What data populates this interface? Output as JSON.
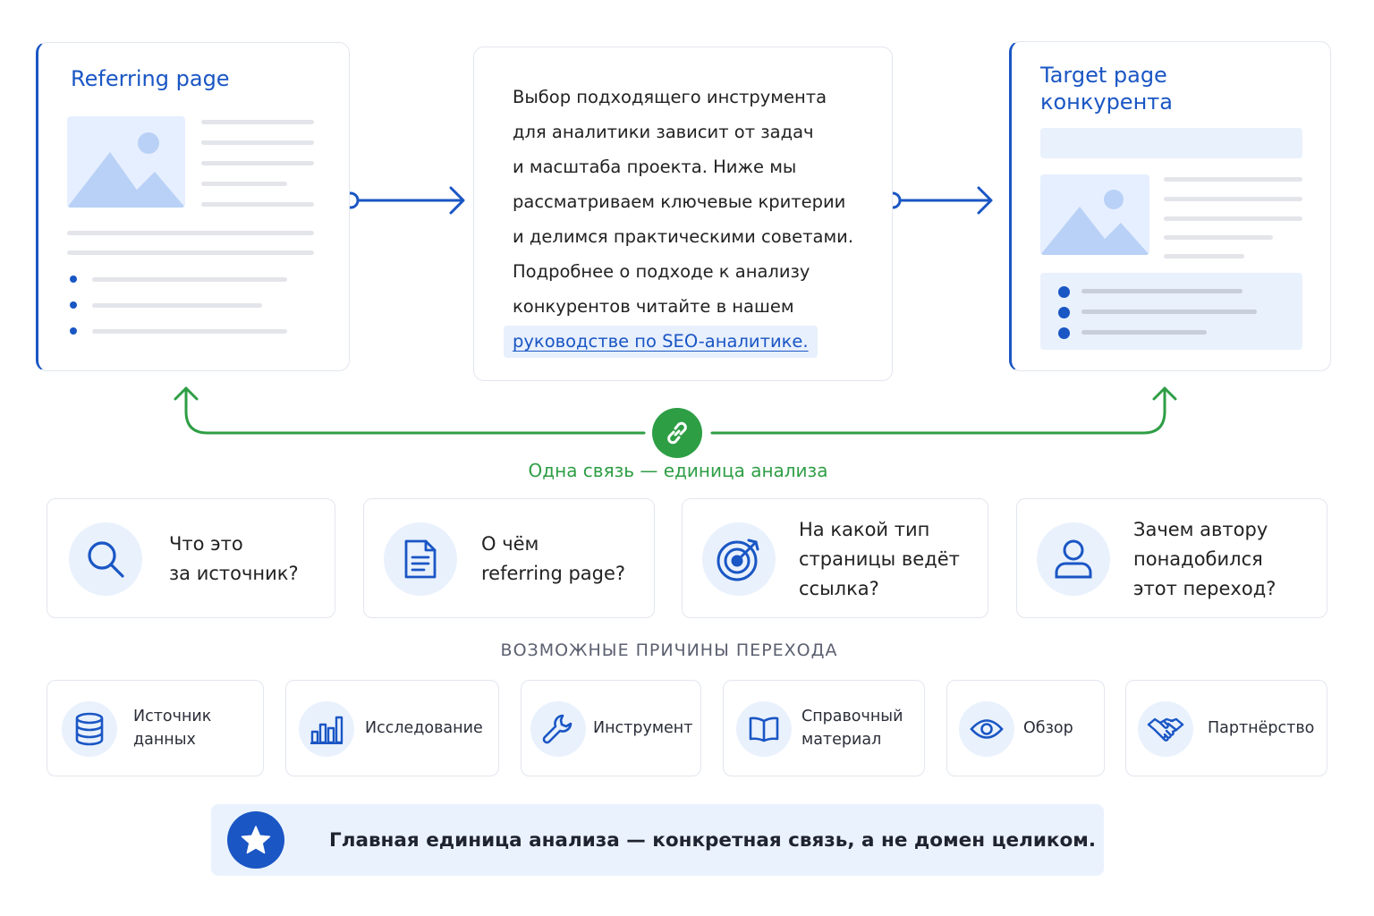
{
  "referring": {
    "title": "Referring page"
  },
  "middle": {
    "lines": [
      "Выбор подходящего инструмента",
      "для аналитики зависит от задач",
      "и масштаба проекта. Ниже мы",
      "рассматриваем ключевые критерии",
      "и делимся практическими советами.",
      "Подробнее о подходе к анализу",
      "конкурентов читайте в нашем"
    ],
    "link_text": "руководстве по SEO-аналитике."
  },
  "target": {
    "title_line1": "Target page",
    "title_line2": "конкурента"
  },
  "connection": {
    "caption": "Одна связь — единица анализа",
    "icon": "link-icon"
  },
  "questions": [
    {
      "icon": "search-icon",
      "line1": "Что это",
      "line2": "за источник?"
    },
    {
      "icon": "document-icon",
      "line1": "О чём",
      "line2": "referring page?"
    },
    {
      "icon": "target-icon",
      "line1": "На какой тип",
      "line2": "страницы ведёт",
      "line3": "ссылка?"
    },
    {
      "icon": "user-icon",
      "line1": "Зачем автору",
      "line2": "понадобился",
      "line3": "этот переход?"
    }
  ],
  "reasons_title": "ВОЗМОЖНЫЕ ПРИЧИНЫ ПЕРЕХОДА",
  "reasons": [
    {
      "icon": "database-icon",
      "line1": "Источник",
      "line2": "данных"
    },
    {
      "icon": "bar-chart-icon",
      "line1": "Исследование"
    },
    {
      "icon": "wrench-icon",
      "line1": "Инструмент"
    },
    {
      "icon": "book-icon",
      "line1": "Справочный",
      "line2": "материал"
    },
    {
      "icon": "eye-icon",
      "line1": "Обзор"
    },
    {
      "icon": "handshake-icon",
      "line1": "Партнёрство"
    }
  ],
  "banner": {
    "icon": "star-icon",
    "text": "Главная единица анализа — конкретная связь, а не домен целиком."
  },
  "colors": {
    "primary": "#1a56c4",
    "green": "#2e9e45",
    "light_blue": "#e9f1fd"
  }
}
